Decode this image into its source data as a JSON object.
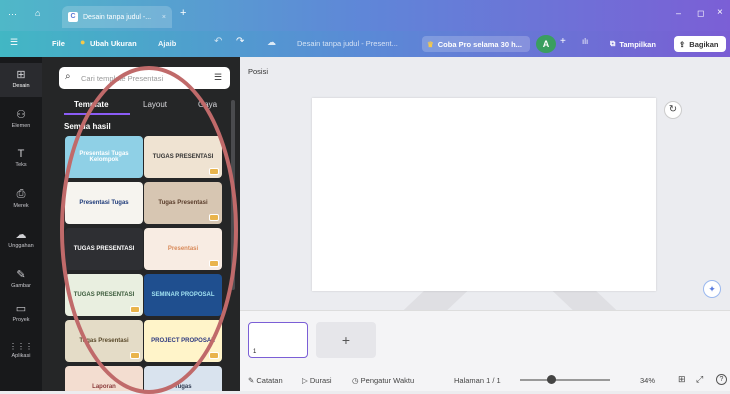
{
  "tabstrip": {
    "menu_glyph": "···",
    "home_glyph": "⌂",
    "tab_title": "Desain tanpa judul -...",
    "tab_close": "×",
    "new_tab": "+",
    "minimize": "–",
    "maximize": "◻",
    "close": "×"
  },
  "menubar": {
    "hamburger": "☰",
    "file": "File",
    "resize": "Ubah Ukuran",
    "magic": "Ajaib",
    "undo": "↶",
    "redo": "↷",
    "cloud": "☁",
    "doc_title": "Desain tanpa judul - Present...",
    "pro": "Coba Pro selama 30 h...",
    "avatar": "A",
    "add": "+",
    "chart": "📊",
    "present": "Tampilkan",
    "share": "Bagikan"
  },
  "rail": [
    {
      "icon": "⊞",
      "label": "Desain",
      "active": true
    },
    {
      "icon": "⚇",
      "label": "Elemen"
    },
    {
      "icon": "T",
      "label": "Teks"
    },
    {
      "icon": "⎙",
      "label": "Merek"
    },
    {
      "icon": "☁",
      "label": "Unggahan"
    },
    {
      "icon": "✎",
      "label": "Gambar"
    },
    {
      "icon": "▭",
      "label": "Proyek"
    },
    {
      "icon": "⋮⋮⋮",
      "label": "Aplikasi"
    }
  ],
  "panel": {
    "search_placeholder": "Cari template Presentasi",
    "tabs": [
      "Template",
      "Layout",
      "Gaya"
    ],
    "section": "Semua hasil",
    "templates": [
      "Presentasi Tugas Kelompok",
      "TUGAS PRESENTASI",
      "Presentasi Tugas",
      "Tugas Presentasi",
      "TUGAS PRESENTASI",
      "Presentasi",
      "TUGAS PRESENTASI",
      "SEMINAR PROPOSAL",
      "Tugas Presentasi",
      "PROJECT PROPOSAL",
      "Laporan",
      "Tugas"
    ]
  },
  "editor": {
    "position": "Posisi",
    "refresh_icon": "↻",
    "magic_icon": "✦",
    "page_num": "1",
    "add_page": "+"
  },
  "status": {
    "notes": "Catatan",
    "duration": "Durasi",
    "timer": "Pengatur Waktu",
    "page": "Halaman 1 / 1",
    "zoom": "34%",
    "zoom_value": 0.34,
    "grid": "⊞",
    "fullscreen": "⤢",
    "help": "?"
  }
}
